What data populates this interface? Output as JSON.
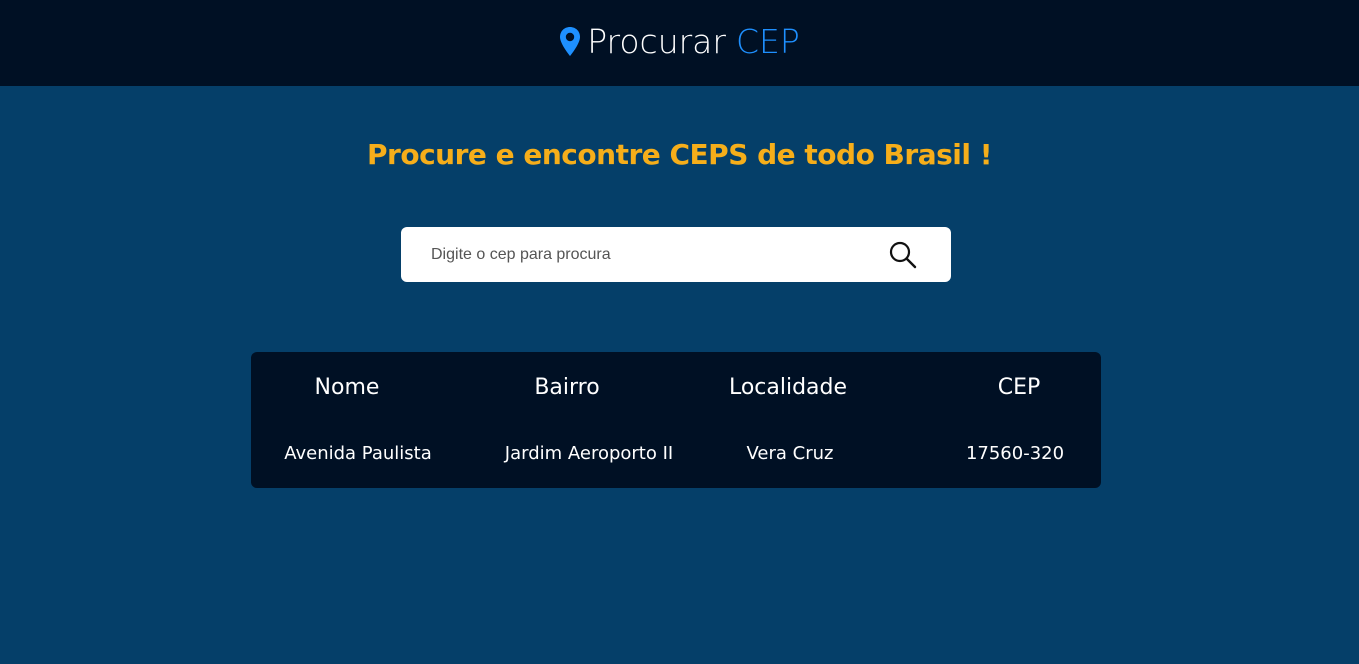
{
  "header": {
    "title_main": "Procurar",
    "title_accent": "CEP",
    "icon": "map-pin-icon",
    "accent_color": "#1e90ff"
  },
  "hero": {
    "headline": "Procure e encontre CEPS de todo Brasil !",
    "headline_color": "#f6ae1a"
  },
  "search": {
    "placeholder": "Digite o cep para procura",
    "value": "",
    "icon": "search-icon"
  },
  "results": {
    "columns": [
      "Nome",
      "Bairro",
      "Localidade",
      "CEP"
    ],
    "rows": [
      [
        "Avenida Paulista",
        "Jardim Aeroporto II",
        "Vera Cruz",
        "17560-320"
      ]
    ]
  },
  "colors": {
    "background": "#053f69",
    "bar": "#001024"
  }
}
